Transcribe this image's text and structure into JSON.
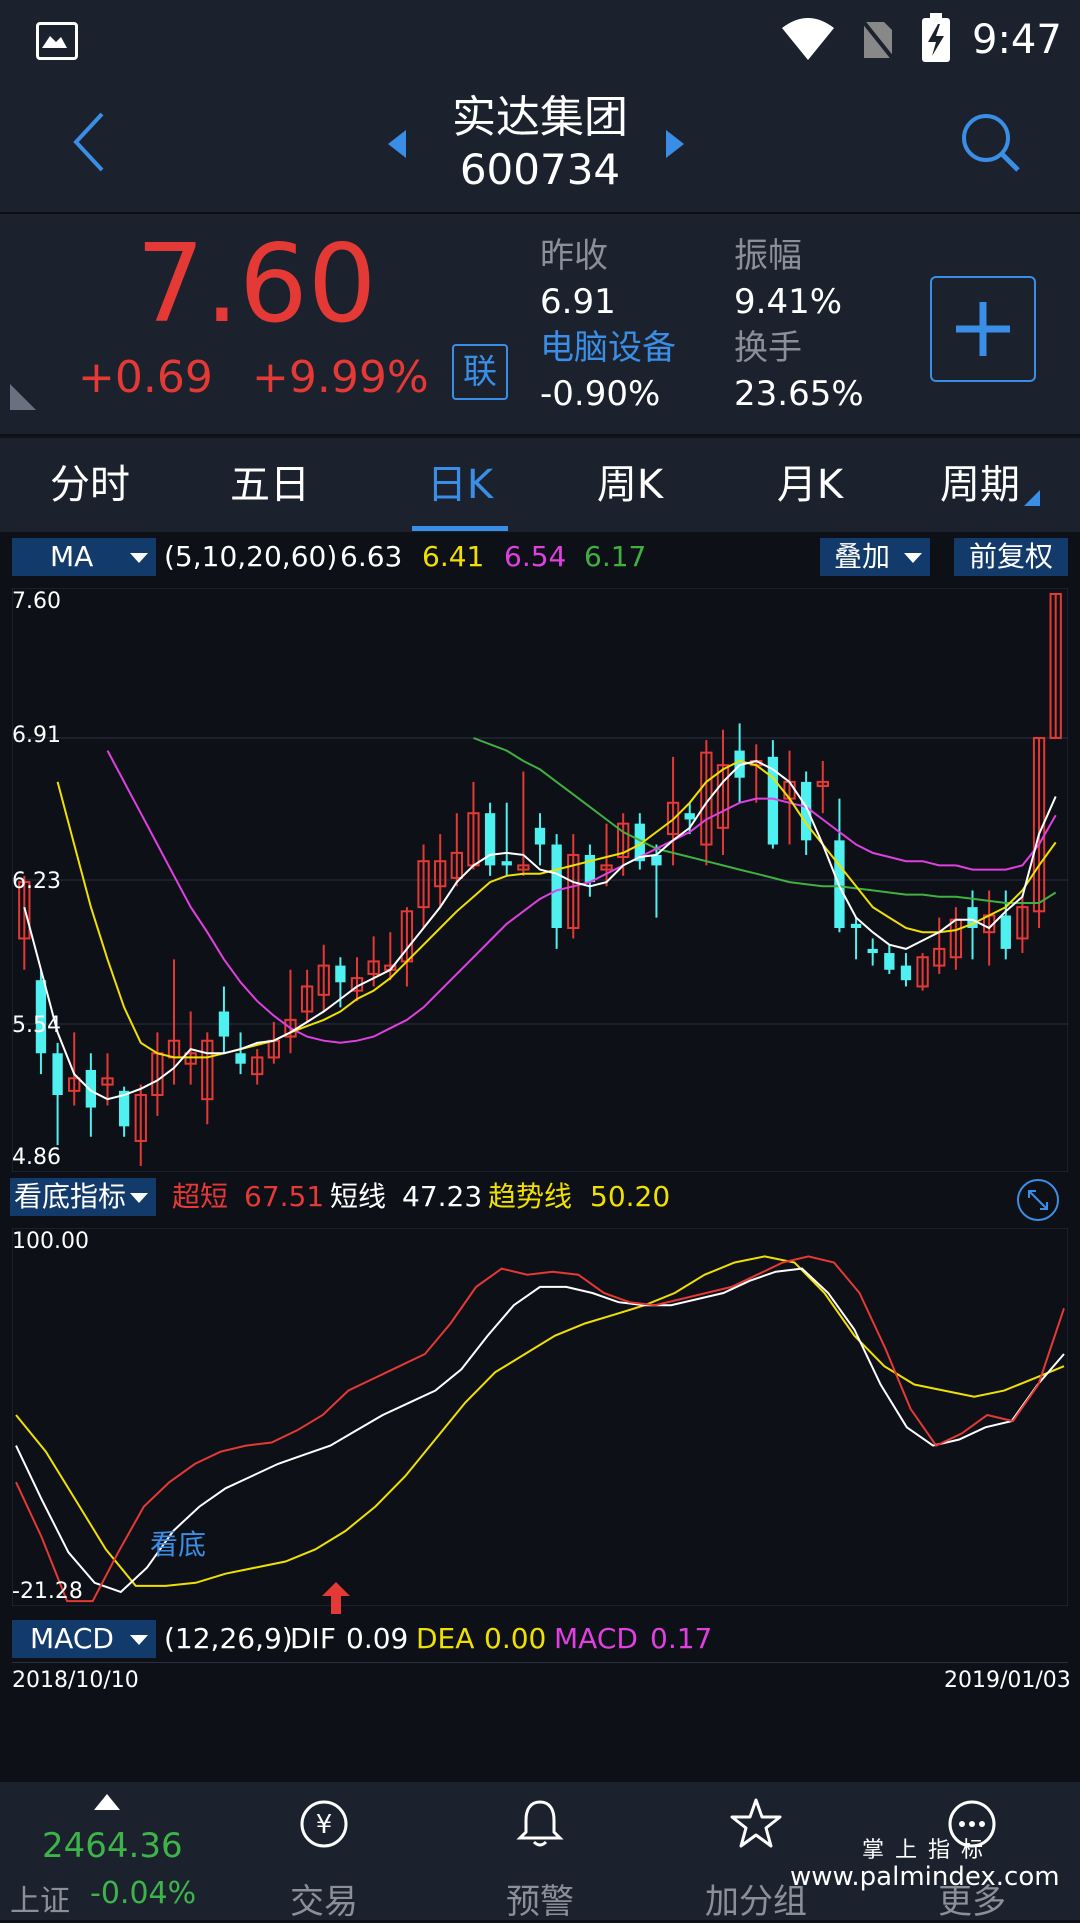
{
  "status_bar": {
    "time": "9:47"
  },
  "header": {
    "name": "实达集团",
    "code": "600734"
  },
  "quote": {
    "price": "7.60",
    "change": "+0.69",
    "change_pct": "+9.99%",
    "link_badge": "联",
    "prev_close_label": "昨收",
    "prev_close": "6.91",
    "amplitude_label": "振幅",
    "amplitude": "9.41%",
    "sector_name": "电脑设备",
    "sector_change": "-0.90%",
    "turnover_label": "换手",
    "turnover": "23.65%",
    "colors": {
      "up": "#e53935",
      "sector": "#3a8ee6"
    }
  },
  "tabs": [
    {
      "label": "分时"
    },
    {
      "label": "五日"
    },
    {
      "label": "日K"
    },
    {
      "label": "周K"
    },
    {
      "label": "月K"
    },
    {
      "label": "周期"
    }
  ],
  "main_indicator": {
    "selector": "MA",
    "params": "(5,10,20,60)",
    "ma5": "6.63",
    "ma10": "6.41",
    "ma20": "6.54",
    "ma60": "6.17",
    "overlay_button": "叠加",
    "adjust_button": "前复权",
    "colors": {
      "ma5": "#ffffff",
      "ma10": "#f0e000",
      "ma20": "#e040e0",
      "ma60": "#40b040"
    }
  },
  "price_axis": {
    "top": "7.60",
    "l1": "6.91",
    "l2": "6.23",
    "l3": "5.54",
    "bottom": "4.86"
  },
  "sub_indicator": {
    "selector": "看底指标",
    "ultra_short_label": "超短",
    "ultra_short": "67.51",
    "short_label": "短线",
    "short": "47.23",
    "trend_label": "趋势线",
    "trend": "50.20",
    "axis_top": "100.00",
    "axis_bottom": "-21.28",
    "signal_label": "看底"
  },
  "macd_indicator": {
    "selector": "MACD",
    "params": "(12,26,9)",
    "dif_label": "DIF",
    "dif": "0.09",
    "dea_label": "DEA",
    "dea": "0.00",
    "macd_label": "MACD",
    "macd": "0.17"
  },
  "date_range": {
    "start": "2018/10/10",
    "end": "2019/01/03"
  },
  "bottom_nav": {
    "index_value": "2464.36",
    "index_name": "上证",
    "index_change": "-0.04%",
    "items": [
      {
        "label": "交易",
        "icon": "yen-exchange-icon"
      },
      {
        "label": "预警",
        "icon": "bell-icon"
      },
      {
        "label": "加分组",
        "icon": "star-icon"
      },
      {
        "label": "更多",
        "icon": "more-icon"
      }
    ]
  },
  "watermark": {
    "line1": "掌 上 指 标",
    "line2": "www.palmindex.com"
  },
  "chart_data": {
    "type": "candlestick",
    "ylim": [
      4.86,
      7.6
    ],
    "candles": [
      [
        5.95,
        6.22,
        5.8,
        6.25
      ],
      [
        5.75,
        5.4,
        5.3,
        5.8
      ],
      [
        5.4,
        5.2,
        4.96,
        5.45
      ],
      [
        5.22,
        5.28,
        5.15,
        5.5
      ],
      [
        5.32,
        5.14,
        5.0,
        5.4
      ],
      [
        5.25,
        5.28,
        5.15,
        5.4
      ],
      [
        5.22,
        5.05,
        5.0,
        5.24
      ],
      [
        4.98,
        5.2,
        4.86,
        5.25
      ],
      [
        5.2,
        5.4,
        5.1,
        5.5
      ],
      [
        5.38,
        5.46,
        5.25,
        5.85
      ],
      [
        5.35,
        5.4,
        5.25,
        5.6
      ],
      [
        5.18,
        5.46,
        5.06,
        5.5
      ],
      [
        5.6,
        5.48,
        5.4,
        5.72
      ],
      [
        5.4,
        5.35,
        5.3,
        5.5
      ],
      [
        5.3,
        5.38,
        5.25,
        5.42
      ],
      [
        5.38,
        5.46,
        5.35,
        5.55
      ],
      [
        5.48,
        5.56,
        5.4,
        5.8
      ],
      [
        5.6,
        5.72,
        5.55,
        5.8
      ],
      [
        5.68,
        5.82,
        5.6,
        5.92
      ],
      [
        5.82,
        5.74,
        5.62,
        5.86
      ],
      [
        5.7,
        5.76,
        5.65,
        5.86
      ],
      [
        5.78,
        5.84,
        5.72,
        5.96
      ],
      [
        5.8,
        5.82,
        5.75,
        5.98
      ],
      [
        5.84,
        6.08,
        5.72,
        6.1
      ],
      [
        6.1,
        6.32,
        6.0,
        6.4
      ],
      [
        6.2,
        6.32,
        6.1,
        6.45
      ],
      [
        6.24,
        6.36,
        6.2,
        6.55
      ],
      [
        6.3,
        6.55,
        6.28,
        6.7
      ],
      [
        6.55,
        6.3,
        6.25,
        6.6
      ],
      [
        6.32,
        6.3,
        6.25,
        6.6
      ],
      [
        6.28,
        6.3,
        6.25,
        6.75
      ],
      [
        6.48,
        6.4,
        6.3,
        6.55
      ],
      [
        6.4,
        6.0,
        5.9,
        6.45
      ],
      [
        6.0,
        6.35,
        5.95,
        6.45
      ],
      [
        6.35,
        6.22,
        6.15,
        6.4
      ],
      [
        6.28,
        6.3,
        6.2,
        6.5
      ],
      [
        6.34,
        6.5,
        6.25,
        6.55
      ],
      [
        6.5,
        6.32,
        6.28,
        6.55
      ],
      [
        6.35,
        6.3,
        6.05,
        6.4
      ],
      [
        6.45,
        6.6,
        6.3,
        6.82
      ],
      [
        6.55,
        6.52,
        6.45,
        6.6
      ],
      [
        6.4,
        6.84,
        6.3,
        6.9
      ],
      [
        6.48,
        6.78,
        6.35,
        6.95
      ],
      [
        6.85,
        6.72,
        6.6,
        6.98
      ],
      [
        6.78,
        6.8,
        6.6,
        6.88
      ],
      [
        6.82,
        6.4,
        6.38,
        6.9
      ],
      [
        6.62,
        6.7,
        6.4,
        6.85
      ],
      [
        6.7,
        6.42,
        6.35,
        6.75
      ],
      [
        6.68,
        6.7,
        6.55,
        6.8
      ],
      [
        6.42,
        6.0,
        5.98,
        6.62
      ],
      [
        6.02,
        6.0,
        5.85,
        6.05
      ],
      [
        5.9,
        5.88,
        5.82,
        5.95
      ],
      [
        5.88,
        5.8,
        5.78,
        5.92
      ],
      [
        5.82,
        5.75,
        5.72,
        5.88
      ],
      [
        5.72,
        5.86,
        5.7,
        5.88
      ],
      [
        5.82,
        5.9,
        5.78,
        6.05
      ],
      [
        5.86,
        6.04,
        5.8,
        6.1
      ],
      [
        6.1,
        6.0,
        5.85,
        6.18
      ],
      [
        5.98,
        6.06,
        5.82,
        6.18
      ],
      [
        6.06,
        5.9,
        5.85,
        6.18
      ],
      [
        5.95,
        6.1,
        5.88,
        6.16
      ],
      [
        6.08,
        6.91,
        6.0,
        6.91
      ],
      [
        6.91,
        7.6,
        6.91,
        7.6
      ]
    ],
    "ma5": [
      6.1,
      5.8,
      5.5,
      5.3,
      5.22,
      5.18,
      5.2,
      5.23,
      5.27,
      5.33,
      5.42,
      5.4,
      5.4,
      5.42,
      5.45,
      5.46,
      5.5,
      5.55,
      5.6,
      5.66,
      5.72,
      5.76,
      5.8,
      5.9,
      6.0,
      6.1,
      6.22,
      6.3,
      6.35,
      6.36,
      6.35,
      6.28,
      6.26,
      6.22,
      6.2,
      6.22,
      6.3,
      6.34,
      6.35,
      6.42,
      6.48,
      6.6,
      6.7,
      6.78,
      6.8,
      6.76,
      6.7,
      6.58,
      6.4,
      6.2,
      6.05,
      5.98,
      5.92,
      5.9,
      5.94,
      5.98,
      6.04,
      6.04,
      6.0,
      6.08,
      6.15,
      6.45,
      6.63
    ],
    "ma10": [
      6.7,
      6.4,
      6.1,
      5.85,
      5.62,
      5.45,
      5.4,
      5.38,
      5.38,
      5.38,
      5.4,
      5.42,
      5.44,
      5.46,
      5.5,
      5.53,
      5.56,
      5.6,
      5.66,
      5.7,
      5.76,
      5.84,
      5.92,
      6.0,
      6.08,
      6.15,
      6.22,
      6.25,
      6.26,
      6.26,
      6.28,
      6.3,
      6.32,
      6.34,
      6.36,
      6.4,
      6.46,
      6.52,
      6.6,
      6.7,
      6.76,
      6.8,
      6.78,
      6.72,
      6.62,
      6.5,
      6.4,
      6.3,
      6.2,
      6.1,
      6.05,
      6.0,
      5.98,
      5.98,
      5.99,
      6.02,
      6.06,
      6.1,
      6.18,
      6.3,
      6.41
    ],
    "ma20": [
      6.85,
      6.7,
      6.55,
      6.4,
      6.25,
      6.1,
      5.98,
      5.85,
      5.74,
      5.65,
      5.58,
      5.52,
      5.48,
      5.46,
      5.45,
      5.46,
      5.48,
      5.52,
      5.56,
      5.62,
      5.7,
      5.78,
      5.86,
      5.94,
      6.02,
      6.08,
      6.14,
      6.18,
      6.2,
      6.22,
      6.26,
      6.3,
      6.34,
      6.38,
      6.42,
      6.46,
      6.52,
      6.56,
      6.6,
      6.62,
      6.62,
      6.6,
      6.58,
      6.52,
      6.46,
      6.4,
      6.36,
      6.34,
      6.32,
      6.32,
      6.3,
      6.3,
      6.28,
      6.28,
      6.28,
      6.3,
      6.4,
      6.54
    ],
    "ma60": [
      6.91,
      6.88,
      6.85,
      6.8,
      6.76,
      6.7,
      6.64,
      6.58,
      6.52,
      6.46,
      6.42,
      6.38,
      6.36,
      6.34,
      6.32,
      6.3,
      6.28,
      6.26,
      6.24,
      6.22,
      6.21,
      6.2,
      6.2,
      6.19,
      6.18,
      6.17,
      6.16,
      6.16,
      6.15,
      6.15,
      6.14,
      6.13,
      6.12,
      6.12,
      6.12,
      6.17
    ]
  }
}
